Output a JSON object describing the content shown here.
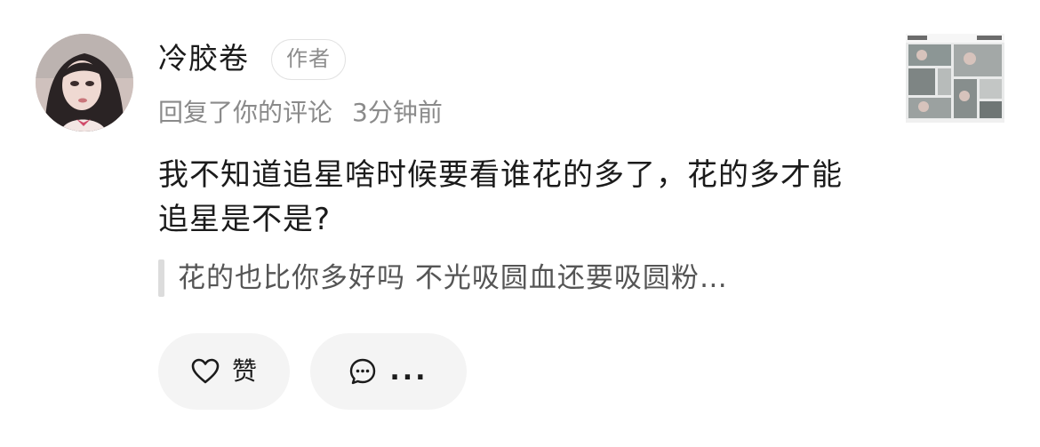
{
  "comment": {
    "username": "冷胶卷",
    "badge": "作者",
    "action": "回复了你的评论",
    "time": "3分钟前",
    "text": "我不知道追星啥时候要看谁花的多了，花的多才能追星是不是?",
    "quoted_text": "花的也比你多好吗 不光吸圆血还要吸圆粉…"
  },
  "actions": {
    "like_label": "赞",
    "reply_label": "...",
    "like_icon": "heart-icon",
    "reply_icon": "comment-bubble-icon"
  },
  "colors": {
    "text_primary": "#1b1b1b",
    "text_secondary": "#8a8a8a",
    "pill_background": "#f4f4f4",
    "quote_bar": "#dcdcdc"
  }
}
